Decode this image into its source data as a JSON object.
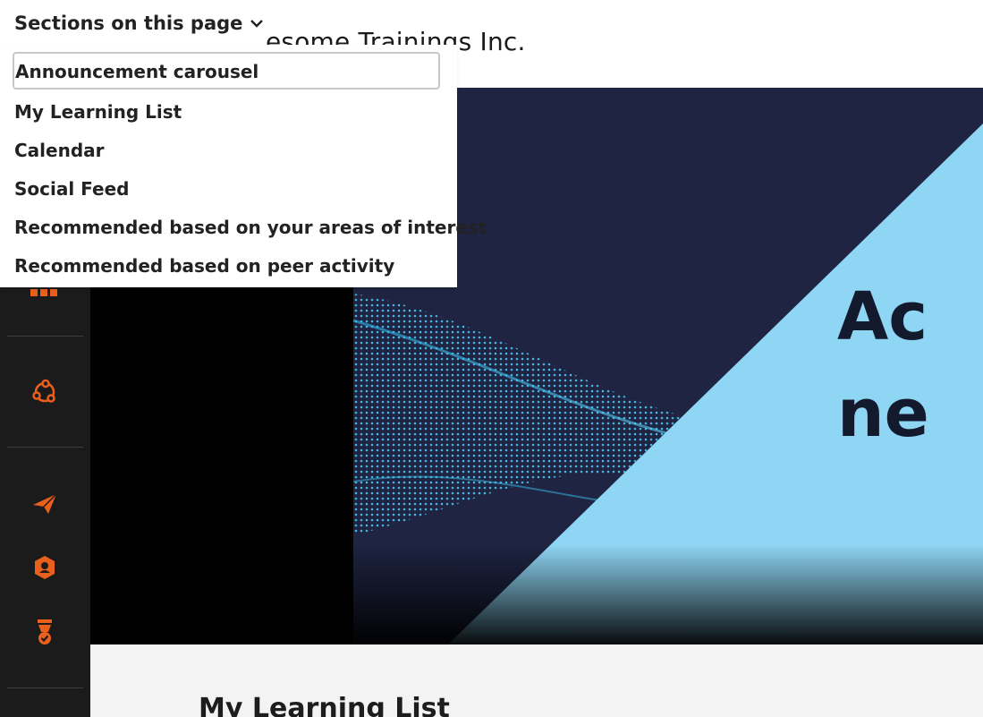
{
  "header": {
    "org_name": "esome Trainings Inc."
  },
  "sections_menu": {
    "toggle_label": "Sections on this page",
    "items": [
      {
        "label": "Announcement carousel",
        "focused": true
      },
      {
        "label": "My Learning List"
      },
      {
        "label": "Calendar"
      },
      {
        "label": "Social Feed"
      },
      {
        "label": "Recommended based on your areas of interest"
      },
      {
        "label": "Recommended based on peer activity"
      }
    ]
  },
  "left_nav": {
    "icons": [
      "menu-icon",
      "network-icon",
      "paper-plane-icon",
      "badge-icon",
      "award-icon"
    ],
    "icon_color": "#e8601c",
    "background": "#1b1b1b"
  },
  "carousel": {
    "title_lines": [
      "Ac",
      "ne"
    ]
  },
  "main": {
    "section_heading": "My Learning List"
  },
  "colors": {
    "accent": "#e8601c",
    "hero_navy": "#1f2540",
    "hero_light_blue": "#8fd6f5"
  }
}
